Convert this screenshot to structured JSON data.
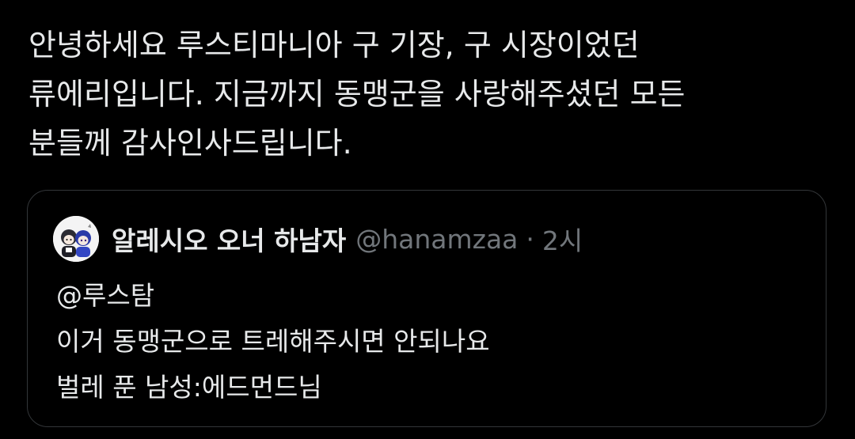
{
  "tweet": {
    "lines": [
      "안녕하세요 루스티마니아 구 기장, 구 시장이었던",
      "류에리입니다. 지금까지 동맹군을 사랑해주셨던 모든",
      "분들께 감사인사드립니다."
    ]
  },
  "quoted_tweet": {
    "avatar_icon": "character-avatar-icon",
    "display_name": "알레시오 오너 하남자",
    "handle": "@hanamzaa",
    "separator": "·",
    "time": "2시",
    "lines": [
      "@루스탐",
      "이거 동맹군으로 트레해주시면 안되나요",
      "벌레 푼 남성:에드먼드님"
    ]
  },
  "colors": {
    "background": "#000000",
    "text": "#e7e9ea",
    "muted": "#71767b",
    "border": "#333639"
  }
}
